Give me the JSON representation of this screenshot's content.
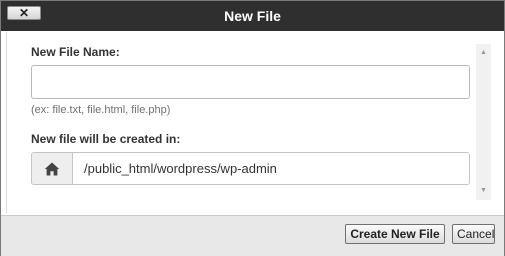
{
  "dialog": {
    "title": "New File",
    "close_label": "✕"
  },
  "form": {
    "file_name_label": "New File Name:",
    "file_name_value": "",
    "file_name_placeholder": "",
    "file_name_hint": "(ex: file.txt, file.html, file.php)",
    "location_label": "New file will be created in:",
    "location_value": "/public_html/wordpress/wp-admin",
    "location_icon": "home-icon"
  },
  "footer": {
    "create_label": "Create New File",
    "cancel_label": "Cancel"
  },
  "colors": {
    "titlebar": "#2f2f2f",
    "footer": "#e8e8e8",
    "addon": "#eeeeee"
  }
}
